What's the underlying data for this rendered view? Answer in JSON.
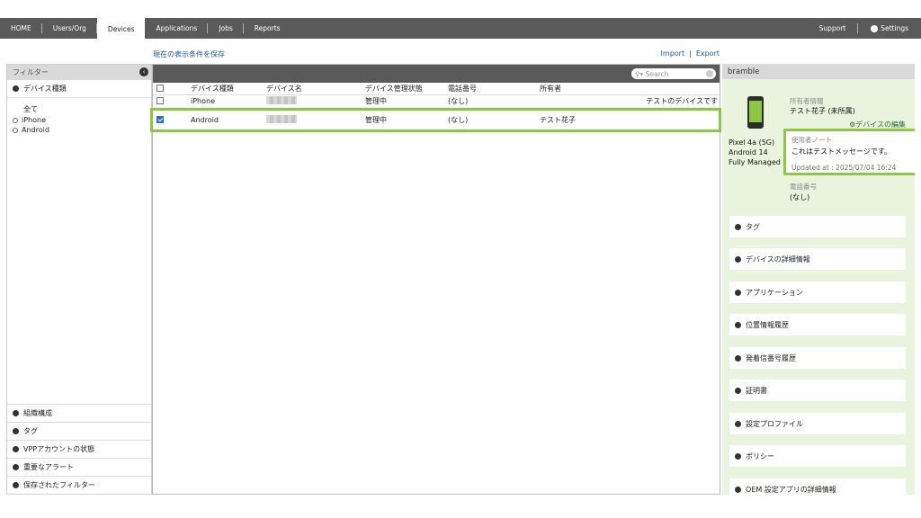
{
  "nav": {
    "tabs": [
      "HOME",
      "Users/Org",
      "Devices",
      "Applications",
      "Jobs",
      "Reports"
    ],
    "support": "Support",
    "settings": "Settings"
  },
  "toolbar": {
    "save_filter": "現在の表示条件を保存",
    "import": "Import",
    "separator": "|",
    "export": "Export"
  },
  "filter": {
    "header": "フィルター",
    "device_type_title": "デバイス種類",
    "options": [
      "全て",
      "iPhone",
      "Android"
    ],
    "bottom_sections": [
      "組織構成",
      "タグ",
      "VPPアカウントの状態",
      "重要なアラート",
      "保存されたフィルター"
    ]
  },
  "grid": {
    "search_placeholder": "Search",
    "columns": [
      "デバイス種類",
      "デバイス名",
      "デバイス管理状態",
      "電話番号",
      "所有者"
    ],
    "rows": [
      {
        "type": "iPhone",
        "status": "管理中",
        "phone": "(なし)",
        "owner": "",
        "extra": "テストのデバイスです"
      },
      {
        "type": "Android",
        "status": "管理中",
        "phone": "(なし)",
        "owner": "テスト花子",
        "extra": ""
      }
    ]
  },
  "detail": {
    "title": "bramble",
    "model_lines": [
      "Pixel 4a (5G)",
      "Android 14",
      "Fully Managed D"
    ],
    "owner_label": "所有者情報",
    "owner_value": "テスト花子 (未所属)",
    "edit_link": "デバイスの編集",
    "note_label": "使用者ノート",
    "note_text": "これはテストメッセージです。",
    "note_updated": "Updated at : 2025/07/04 16:24",
    "phone_label": "電話番号",
    "phone_value": "(なし)",
    "sections": [
      "タグ",
      "デバイスの詳細情報",
      "アプリケーション",
      "位置情報履歴",
      "発着信番号履歴",
      "証明書",
      "設定プロファイル",
      "ポリシー",
      "OEM 設定アプリの詳細情報"
    ]
  },
  "colors": {
    "accent_green": "#8dc63f",
    "link_blue": "#1a5aa6",
    "nav_gray": "#5a5a5a"
  }
}
